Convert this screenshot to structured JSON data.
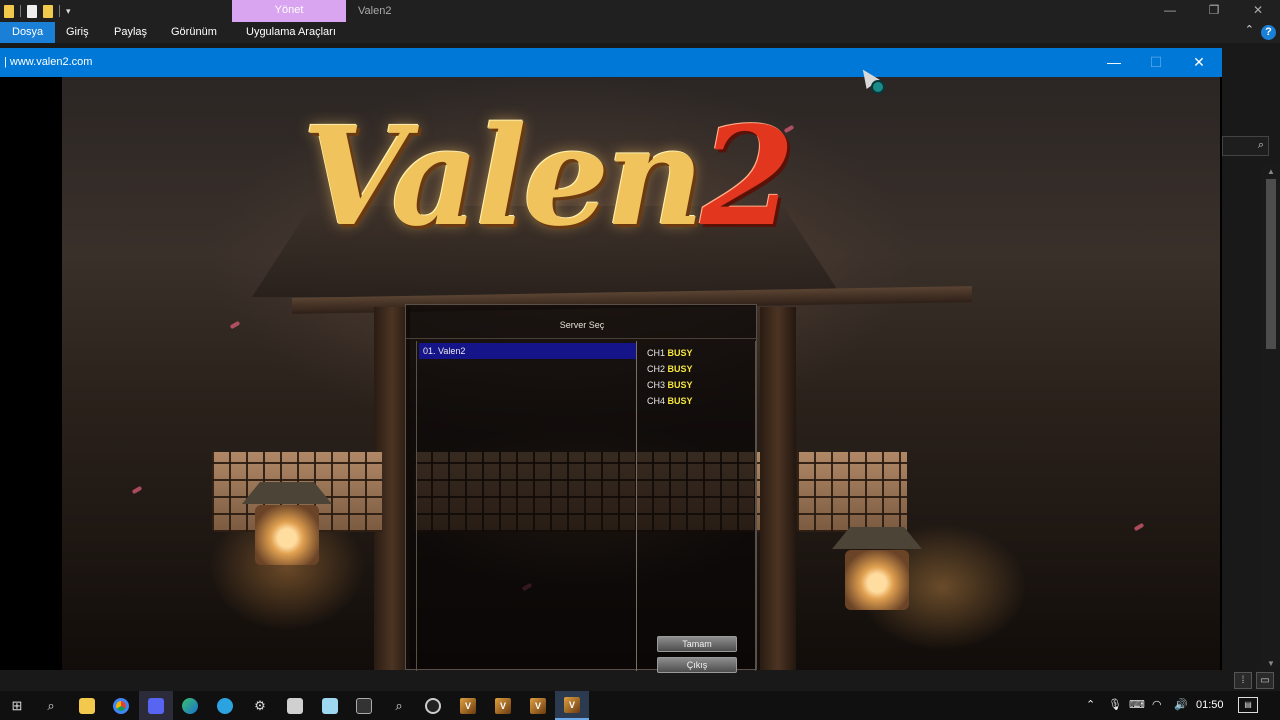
{
  "explorer": {
    "context_tab": "Yönet",
    "window_name": "Valen2",
    "ribbon_tabs": [
      "Dosya",
      "Giriş",
      "Paylaş",
      "Görünüm",
      "Uygulama Araçları"
    ],
    "help_glyph": "?"
  },
  "game_window": {
    "title": "| www.valen2.com",
    "logo": {
      "word": "Valen",
      "number": "2"
    }
  },
  "server_dialog": {
    "title": "Server Seç",
    "servers": [
      {
        "label": "01. Valen2",
        "selected": true
      }
    ],
    "channels": [
      {
        "name": "CH1",
        "status": "BUSY"
      },
      {
        "name": "CH2",
        "status": "BUSY"
      },
      {
        "name": "CH3",
        "status": "BUSY"
      },
      {
        "name": "CH4",
        "status": "BUSY"
      }
    ],
    "ok_label": "Tamam",
    "exit_label": "Çıkış"
  },
  "taskbar": {
    "clock": "01:50",
    "apps": [
      "start-icon",
      "search-icon",
      "file-explorer-icon",
      "chrome-icon",
      "discord-icon",
      "edge-icon",
      "telegram-icon",
      "settings-icon",
      "7zip-icon",
      "notepad-icon",
      "terminal-icon",
      "search-app-icon",
      "obs-icon",
      "valen2-icon",
      "valen2-icon",
      "valen2-icon",
      "valen2-icon"
    ],
    "valen_label": "V"
  },
  "colors": {
    "title_bar_blue": "#0078d7",
    "selection_blue": "#151488",
    "status_yellow": "#f5e642",
    "manage_tab": "#d9a4f0"
  }
}
